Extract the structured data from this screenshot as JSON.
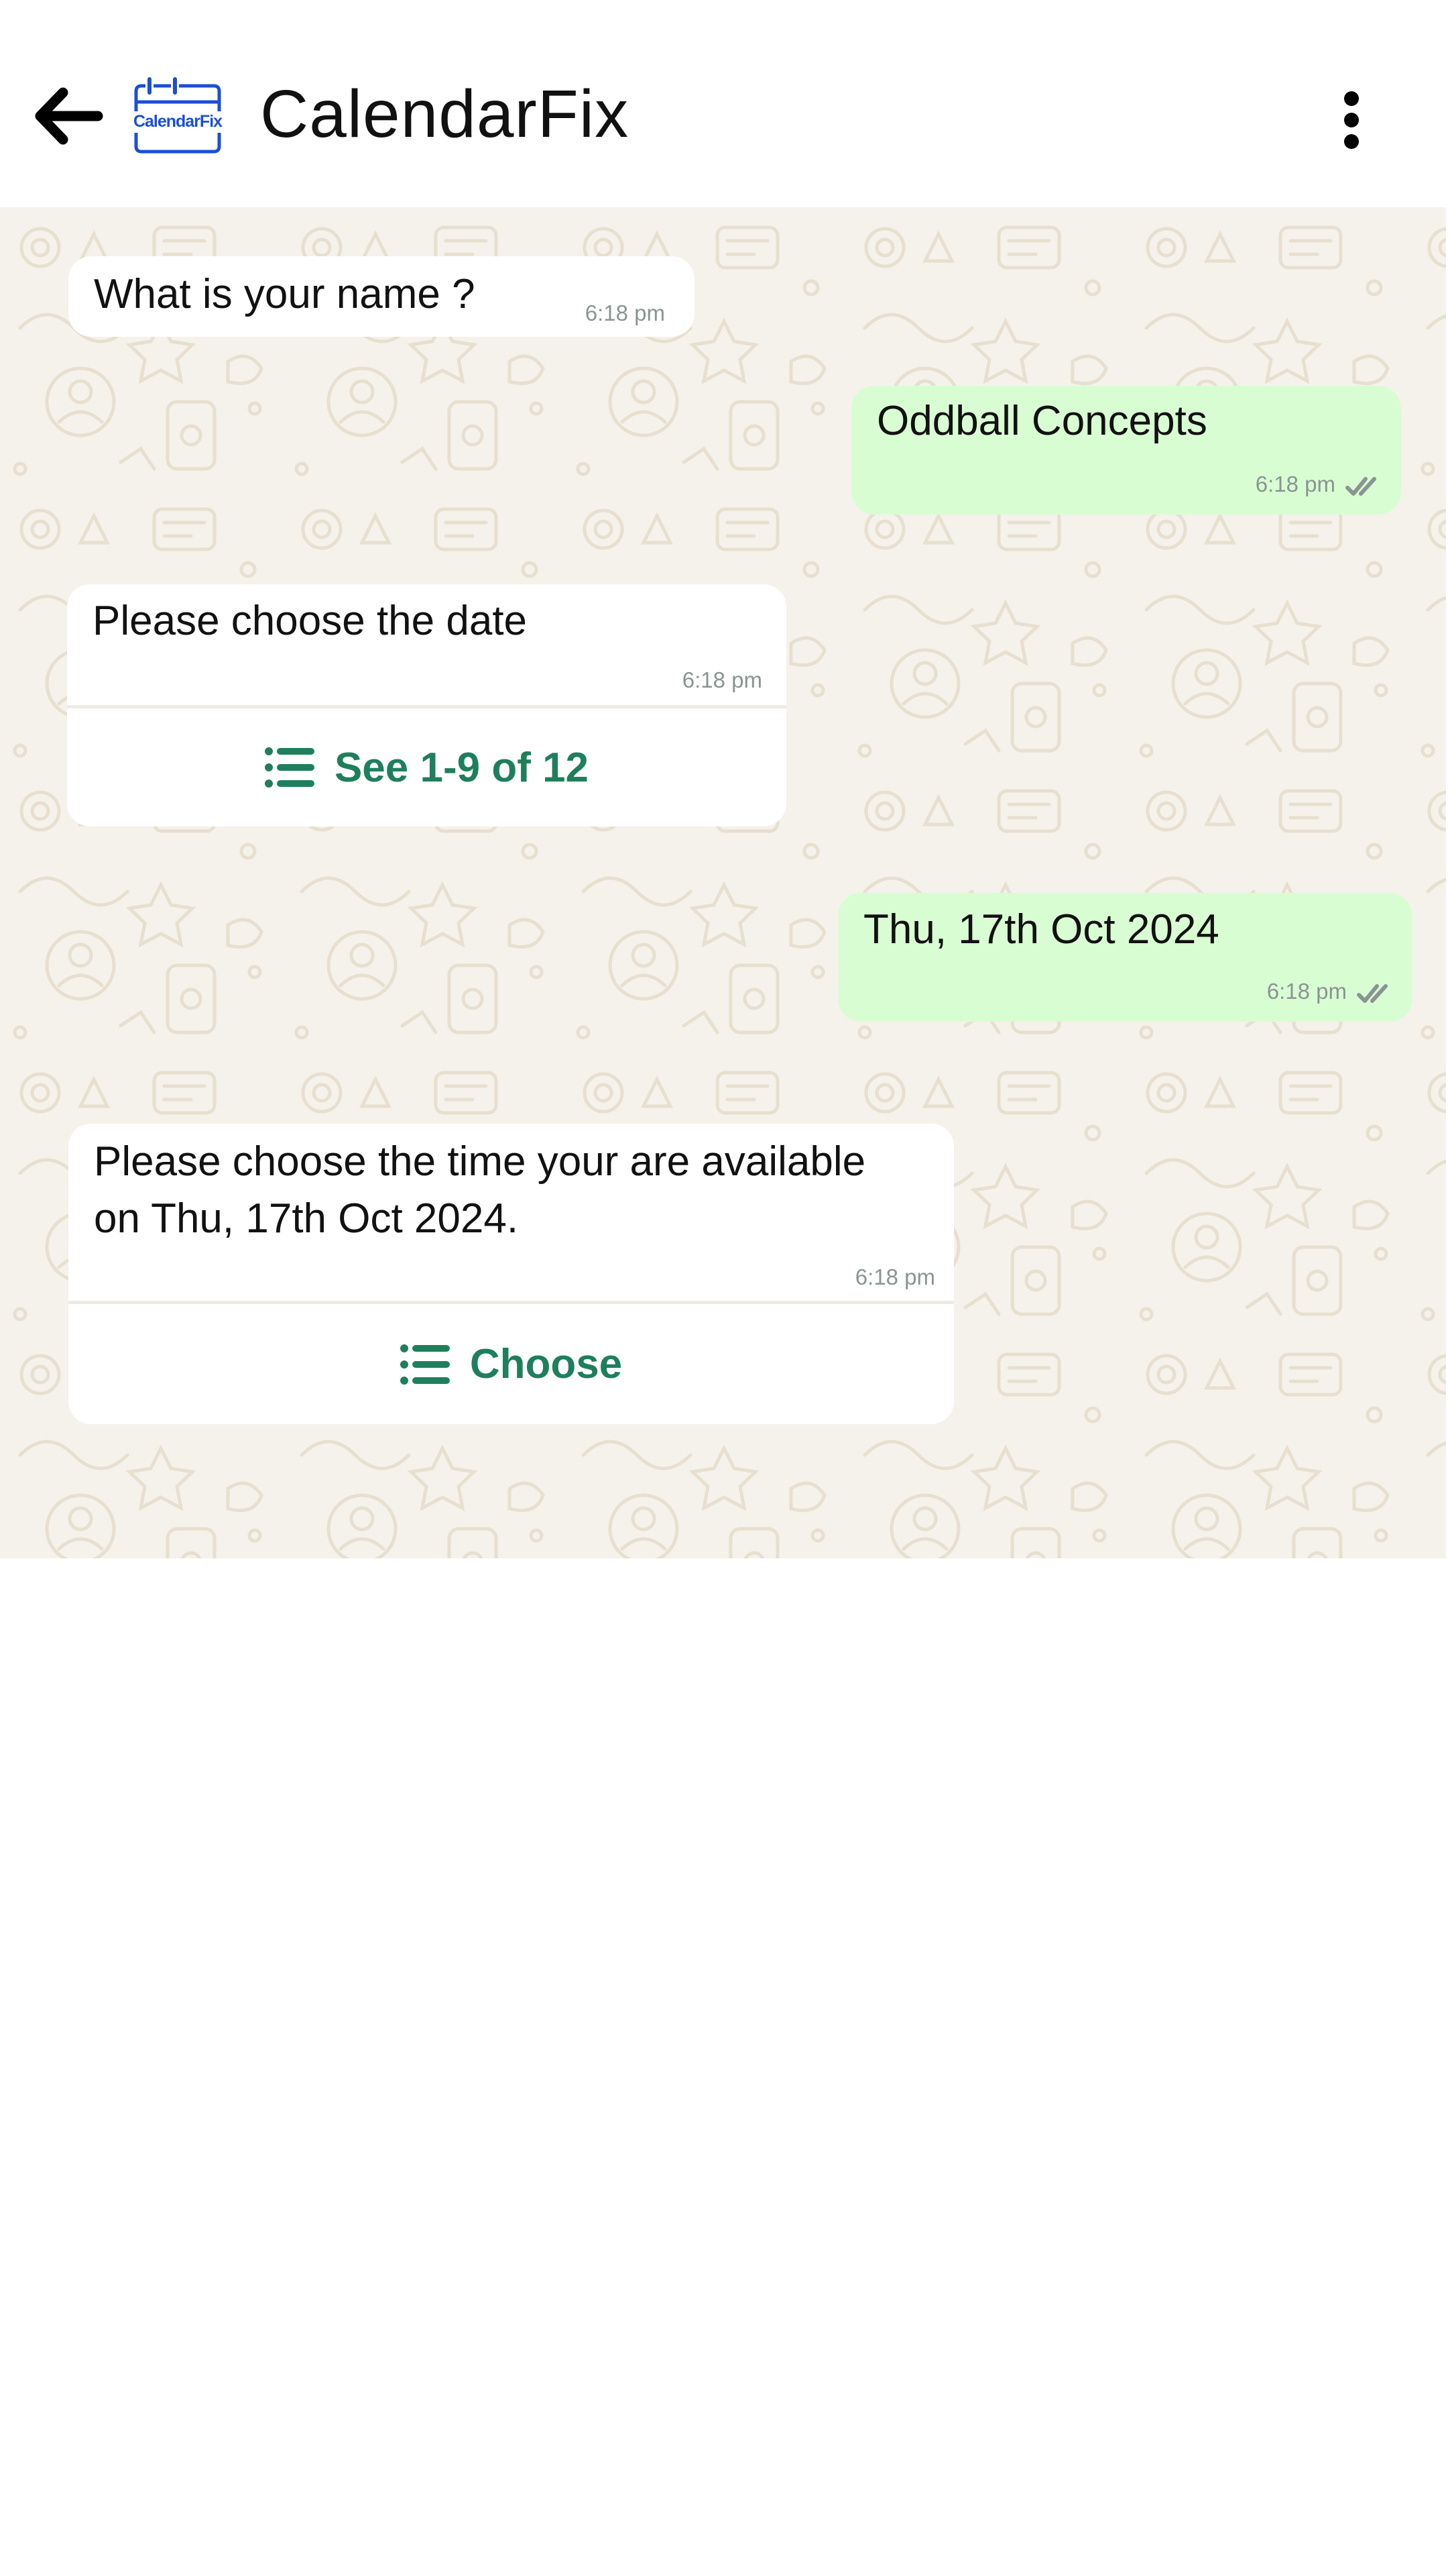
{
  "header": {
    "title": "CalendarFix",
    "logo_text": "CalendarFix",
    "back_icon": "arrow-left-icon",
    "menu_icon": "more-vertical-icon"
  },
  "colors": {
    "brand_blue": "#1a4fd6",
    "action_green": "#1f7f5c",
    "outgoing_bubble": "#d9fdd3",
    "incoming_bubble": "#ffffff",
    "chat_background": "#f5f2eb",
    "timestamp": "#8a9592"
  },
  "messages": [
    {
      "direction": "incoming",
      "text": "What is your name ?",
      "time": "6:18 pm"
    },
    {
      "direction": "outgoing",
      "text": "Oddball Concepts",
      "time": "6:18 pm",
      "status": "read"
    },
    {
      "direction": "incoming",
      "text": "Please choose the date",
      "time": "6:18 pm",
      "action": {
        "label": "See 1-9 of 12",
        "icon": "list-icon"
      }
    },
    {
      "direction": "outgoing",
      "text": "Thu, 17th Oct 2024",
      "time": "6:18 pm",
      "status": "read"
    },
    {
      "direction": "incoming",
      "text": "Please choose the time your are available\non Thu, 17th Oct 2024.",
      "time": "6:18 pm",
      "action": {
        "label": "Choose",
        "icon": "list-icon"
      }
    }
  ]
}
